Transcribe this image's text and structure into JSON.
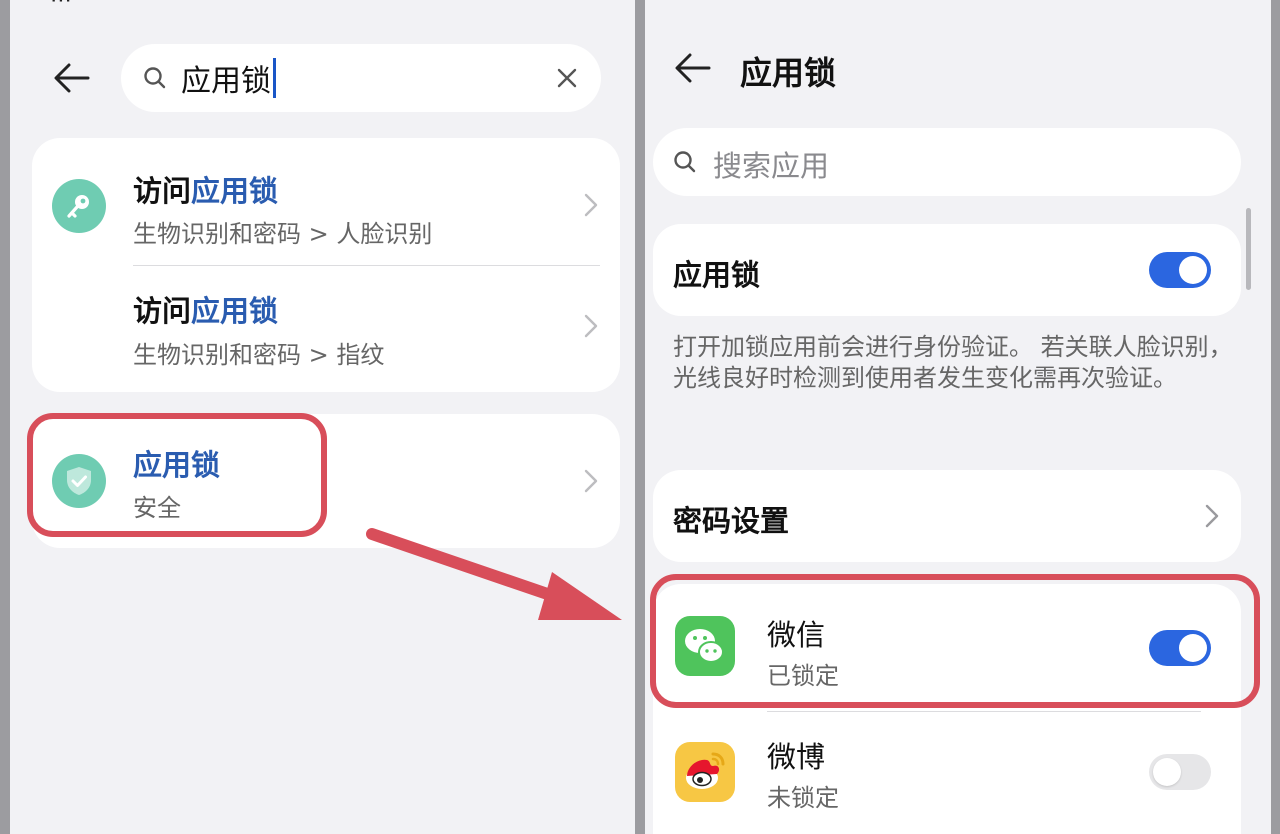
{
  "left": {
    "search": {
      "query": "应用锁",
      "placeholder": ""
    },
    "results": [
      {
        "title_prefix": "访问",
        "title_highlight": "应用锁",
        "path": "生物识别和密码 > 人脸识别",
        "icon": "key-icon"
      },
      {
        "title_prefix": "访问",
        "title_highlight": "应用锁",
        "path": "生物识别和密码 > 指纹",
        "icon": ""
      },
      {
        "title_prefix": "",
        "title_highlight": "应用锁",
        "path": "安全",
        "icon": "shield-check-icon"
      }
    ]
  },
  "right": {
    "title": "应用锁",
    "search_placeholder": "搜索应用",
    "app_lock": {
      "label": "应用锁",
      "enabled": true
    },
    "description": "打开加锁应用前会进行身份验证。 若关联人脸识别，光线良好时检测到使用者发生变化需再次验证。",
    "password_settings": "密码设置",
    "apps": [
      {
        "name": "微信",
        "status": "已锁定",
        "locked": true,
        "icon": "wechat-icon"
      },
      {
        "name": "微博",
        "status": "未锁定",
        "locked": false,
        "icon": "weibo-icon"
      }
    ]
  },
  "colors": {
    "accent_blue": "#2b66e0",
    "highlight_text": "#2a5cb0",
    "annotation_red": "#d84e5a",
    "icon_teal": "#6fccb2",
    "wechat_green": "#4fc45c",
    "weibo_yellow": "#f7c744"
  }
}
